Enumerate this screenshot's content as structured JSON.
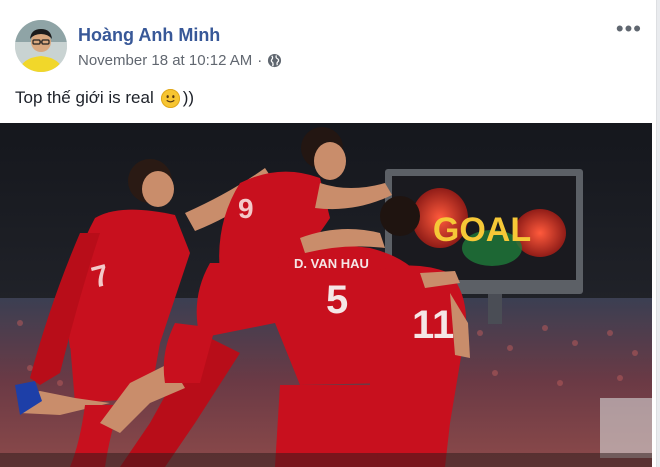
{
  "post": {
    "author": "Hoàng Anh Minh",
    "timestamp": "November 18 at 10:12 AM",
    "separator": "·",
    "privacy_icon": "globe-icon",
    "more_icon": "more-options-icon",
    "text": "Top thế giới is real",
    "emoji": "slightly-smiling-face-icon",
    "text_suffix": "))"
  },
  "photo": {
    "scoreboard_text": "GOAL",
    "jersey_name": "D. VAN HAU",
    "jersey_numbers": [
      "5",
      "11",
      "9",
      "7"
    ]
  },
  "colors": {
    "author_link": "#385898",
    "jersey_red": "#c8101e",
    "goal_yellow": "#f6c837"
  }
}
